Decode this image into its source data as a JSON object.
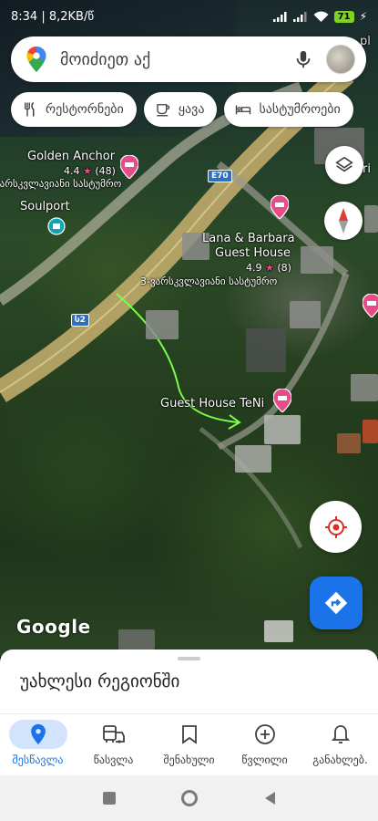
{
  "status_bar": {
    "time": "8:34",
    "network_speed": "8,2KB/წ",
    "battery": "71"
  },
  "search": {
    "placeholder": "მოიძიეთ აქ"
  },
  "chips": [
    {
      "label": "რესტორნები",
      "icon": "fork-knife-icon"
    },
    {
      "label": "ყავა",
      "icon": "coffee-cup-icon"
    },
    {
      "label": "სასტუმროები",
      "icon": "bed-icon"
    }
  ],
  "map": {
    "places": [
      {
        "name": "Golden Anchor",
        "rating": "4.4",
        "reviews": "(48)",
        "type": "ვარსკვლავიანი სასტუმრო"
      },
      {
        "name": "Soulport"
      },
      {
        "name_line1": "Lana & Barbara",
        "name_line2": "Guest House",
        "rating": "4.9",
        "reviews": "(8)",
        "type": "3-ვარსკვლავიანი სასტუმრო"
      },
      {
        "name": "Guest House TeNi"
      }
    ],
    "road_e70": "E70",
    "road_s2": "Ⴑ2",
    "edge_label_top": "pl",
    "edge_label_right": "ri"
  },
  "google_logo": "Google",
  "sheet": {
    "title": "უახლესი რეგიონში"
  },
  "bottom_nav": [
    {
      "label": "შესწავლა",
      "icon": "explore-pin-icon",
      "active": true
    },
    {
      "label": "წასვლა",
      "icon": "commute-icon",
      "active": false
    },
    {
      "label": "შენახული",
      "icon": "bookmark-icon",
      "active": false
    },
    {
      "label": "წვლილი",
      "icon": "add-circle-icon",
      "active": false
    },
    {
      "label": "განახლებ.",
      "icon": "bell-icon",
      "active": false
    }
  ],
  "colors": {
    "accent": "#1a73e8",
    "pin_pink": "#e84b8a",
    "chip_bg": "#ffffff"
  }
}
